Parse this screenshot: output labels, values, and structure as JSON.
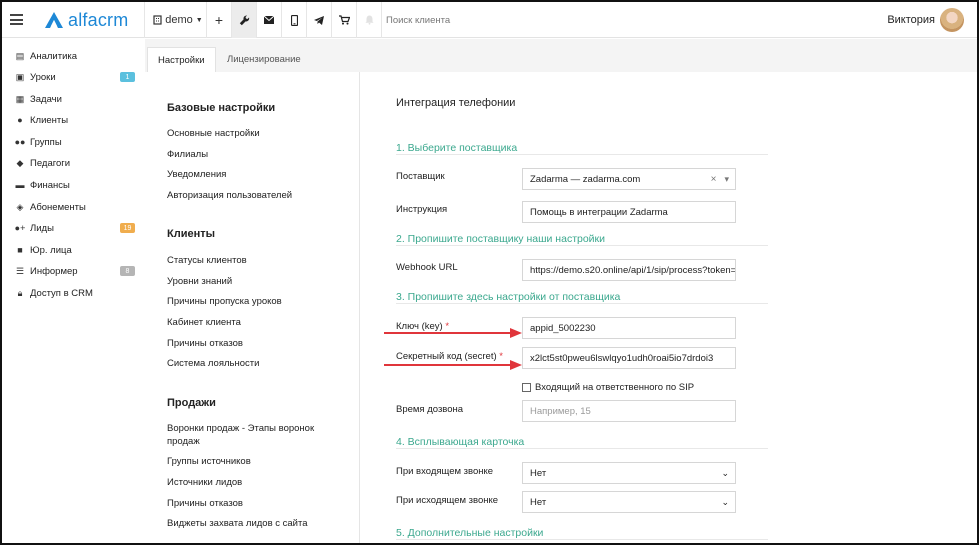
{
  "topbar": {
    "logo_text": "alfacrm",
    "branch": "demo",
    "search_placeholder": "Поиск клиента",
    "user_name": "Виктория",
    "brand_color": "#1e88d6",
    "icons": [
      "plus-icon",
      "wrench-icon",
      "mail-icon",
      "phone-icon",
      "telegram-icon",
      "cart-icon",
      "bell-icon"
    ]
  },
  "sidebar": {
    "items": [
      {
        "label": "Аналитика",
        "icon": "map-icon"
      },
      {
        "label": "Уроки",
        "icon": "calendar-icon",
        "badge": "1",
        "badge_color": "#5bc0de"
      },
      {
        "label": "Задачи",
        "icon": "clipboard-icon"
      },
      {
        "label": "Клиенты",
        "icon": "user-icon"
      },
      {
        "label": "Группы",
        "icon": "users-icon"
      },
      {
        "label": "Педагоги",
        "icon": "graduation-cap-icon"
      },
      {
        "label": "Финансы",
        "icon": "money-icon"
      },
      {
        "label": "Абонементы",
        "icon": "tag-icon"
      },
      {
        "label": "Лиды",
        "icon": "user-plus-icon",
        "badge": "19",
        "badge_color": "#f0ad4e"
      },
      {
        "label": "Юр. лица",
        "icon": "briefcase-icon"
      },
      {
        "label": "Информер",
        "icon": "list-icon",
        "badge": "8",
        "badge_color": "#b5b5b5"
      },
      {
        "label": "Доступ в CRM",
        "icon": "lock-icon"
      }
    ]
  },
  "tabs": [
    {
      "label": "Настройки",
      "active": true
    },
    {
      "label": "Лицензирование",
      "active": false
    }
  ],
  "settings": {
    "basic_title": "Базовые настройки",
    "basic": [
      "Основные настройки",
      "Филиалы",
      "Уведомления",
      "Авторизация пользователей"
    ],
    "clients_title": "Клиенты",
    "clients": [
      "Статусы клиентов",
      "Уровни знаний",
      "Причины пропуска уроков",
      "Кабинет клиента",
      "Причины отказов",
      "Система лояльности"
    ],
    "sales_title": "Продажи",
    "sales": [
      "Воронки продаж - Этапы воронок продаж",
      "Группы источников",
      "Источники лидов",
      "Причины отказов",
      "Виджеты захвата лидов с сайта"
    ]
  },
  "form": {
    "title": "Интеграция телефонии",
    "step1": "1. Выберите поставщика",
    "provider_label": "Поставщик",
    "provider_value": "Zadarma — zadarma.com",
    "instruction_label": "Инструкция",
    "instruction_value": "Помощь в интеграции Zadarma",
    "step2": "2. Пропишите поставщику наши настройки",
    "webhook_label": "Webhook URL",
    "webhook_value": "https://demo.s20.online/api/1/sip/process?token=",
    "step3": "3. Пропишите здесь настройки от поставщика",
    "key_label": "Ключ (key)",
    "key_value": "appid_5002230",
    "secret_label": "Секретный код (secret)",
    "secret_value": "x2lct5st0pweu6lswlqyo1udh0roai5io7drdoi3",
    "required_mark": "*",
    "checkbox_label": "Входящий на ответственного по SIP",
    "dial_label": "Время дозвона",
    "dial_placeholder": "Например, 15",
    "step4": "4. Всплывающая карточка",
    "incoming_label": "При входящем звонке",
    "incoming_value": "Нет",
    "outgoing_label": "При исходящем звонке",
    "outgoing_value": "Нет",
    "step5": "5. Дополнительные настройки",
    "accent_color": "#3ba88e",
    "arrow_color": "#e0353b"
  }
}
